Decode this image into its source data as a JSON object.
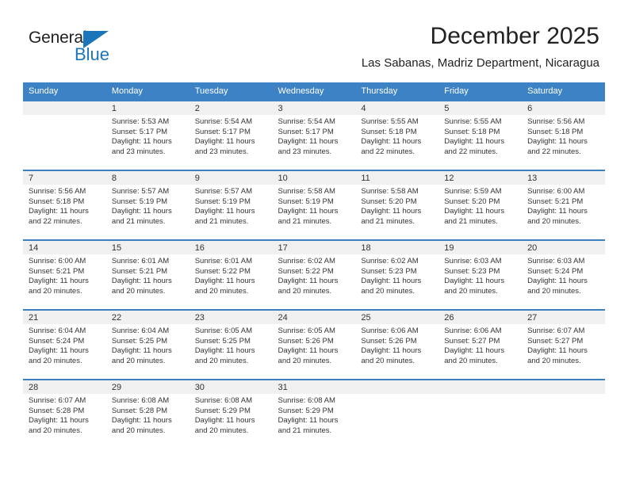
{
  "brand": {
    "name_part1": "General",
    "name_part2": "Blue",
    "accent_color": "#1b75bb",
    "triangle_icon": "triangle-icon"
  },
  "header": {
    "title": "December 2025",
    "subtitle": "Las Sabanas, Madriz Department, Nicaragua"
  },
  "calendar": {
    "header_bg": "#3c82c4",
    "daynum_bg": "#f0f0f0",
    "weekday_names": [
      "Sunday",
      "Monday",
      "Tuesday",
      "Wednesday",
      "Thursday",
      "Friday",
      "Saturday"
    ],
    "weeks": [
      {
        "days": [
          {
            "num": "",
            "lines": []
          },
          {
            "num": "1",
            "lines": [
              "Sunrise: 5:53 AM",
              "Sunset: 5:17 PM",
              "Daylight: 11 hours",
              "and 23 minutes."
            ]
          },
          {
            "num": "2",
            "lines": [
              "Sunrise: 5:54 AM",
              "Sunset: 5:17 PM",
              "Daylight: 11 hours",
              "and 23 minutes."
            ]
          },
          {
            "num": "3",
            "lines": [
              "Sunrise: 5:54 AM",
              "Sunset: 5:17 PM",
              "Daylight: 11 hours",
              "and 23 minutes."
            ]
          },
          {
            "num": "4",
            "lines": [
              "Sunrise: 5:55 AM",
              "Sunset: 5:18 PM",
              "Daylight: 11 hours",
              "and 22 minutes."
            ]
          },
          {
            "num": "5",
            "lines": [
              "Sunrise: 5:55 AM",
              "Sunset: 5:18 PM",
              "Daylight: 11 hours",
              "and 22 minutes."
            ]
          },
          {
            "num": "6",
            "lines": [
              "Sunrise: 5:56 AM",
              "Sunset: 5:18 PM",
              "Daylight: 11 hours",
              "and 22 minutes."
            ]
          }
        ]
      },
      {
        "days": [
          {
            "num": "7",
            "lines": [
              "Sunrise: 5:56 AM",
              "Sunset: 5:18 PM",
              "Daylight: 11 hours",
              "and 22 minutes."
            ]
          },
          {
            "num": "8",
            "lines": [
              "Sunrise: 5:57 AM",
              "Sunset: 5:19 PM",
              "Daylight: 11 hours",
              "and 21 minutes."
            ]
          },
          {
            "num": "9",
            "lines": [
              "Sunrise: 5:57 AM",
              "Sunset: 5:19 PM",
              "Daylight: 11 hours",
              "and 21 minutes."
            ]
          },
          {
            "num": "10",
            "lines": [
              "Sunrise: 5:58 AM",
              "Sunset: 5:19 PM",
              "Daylight: 11 hours",
              "and 21 minutes."
            ]
          },
          {
            "num": "11",
            "lines": [
              "Sunrise: 5:58 AM",
              "Sunset: 5:20 PM",
              "Daylight: 11 hours",
              "and 21 minutes."
            ]
          },
          {
            "num": "12",
            "lines": [
              "Sunrise: 5:59 AM",
              "Sunset: 5:20 PM",
              "Daylight: 11 hours",
              "and 21 minutes."
            ]
          },
          {
            "num": "13",
            "lines": [
              "Sunrise: 6:00 AM",
              "Sunset: 5:21 PM",
              "Daylight: 11 hours",
              "and 20 minutes."
            ]
          }
        ]
      },
      {
        "days": [
          {
            "num": "14",
            "lines": [
              "Sunrise: 6:00 AM",
              "Sunset: 5:21 PM",
              "Daylight: 11 hours",
              "and 20 minutes."
            ]
          },
          {
            "num": "15",
            "lines": [
              "Sunrise: 6:01 AM",
              "Sunset: 5:21 PM",
              "Daylight: 11 hours",
              "and 20 minutes."
            ]
          },
          {
            "num": "16",
            "lines": [
              "Sunrise: 6:01 AM",
              "Sunset: 5:22 PM",
              "Daylight: 11 hours",
              "and 20 minutes."
            ]
          },
          {
            "num": "17",
            "lines": [
              "Sunrise: 6:02 AM",
              "Sunset: 5:22 PM",
              "Daylight: 11 hours",
              "and 20 minutes."
            ]
          },
          {
            "num": "18",
            "lines": [
              "Sunrise: 6:02 AM",
              "Sunset: 5:23 PM",
              "Daylight: 11 hours",
              "and 20 minutes."
            ]
          },
          {
            "num": "19",
            "lines": [
              "Sunrise: 6:03 AM",
              "Sunset: 5:23 PM",
              "Daylight: 11 hours",
              "and 20 minutes."
            ]
          },
          {
            "num": "20",
            "lines": [
              "Sunrise: 6:03 AM",
              "Sunset: 5:24 PM",
              "Daylight: 11 hours",
              "and 20 minutes."
            ]
          }
        ]
      },
      {
        "days": [
          {
            "num": "21",
            "lines": [
              "Sunrise: 6:04 AM",
              "Sunset: 5:24 PM",
              "Daylight: 11 hours",
              "and 20 minutes."
            ]
          },
          {
            "num": "22",
            "lines": [
              "Sunrise: 6:04 AM",
              "Sunset: 5:25 PM",
              "Daylight: 11 hours",
              "and 20 minutes."
            ]
          },
          {
            "num": "23",
            "lines": [
              "Sunrise: 6:05 AM",
              "Sunset: 5:25 PM",
              "Daylight: 11 hours",
              "and 20 minutes."
            ]
          },
          {
            "num": "24",
            "lines": [
              "Sunrise: 6:05 AM",
              "Sunset: 5:26 PM",
              "Daylight: 11 hours",
              "and 20 minutes."
            ]
          },
          {
            "num": "25",
            "lines": [
              "Sunrise: 6:06 AM",
              "Sunset: 5:26 PM",
              "Daylight: 11 hours",
              "and 20 minutes."
            ]
          },
          {
            "num": "26",
            "lines": [
              "Sunrise: 6:06 AM",
              "Sunset: 5:27 PM",
              "Daylight: 11 hours",
              "and 20 minutes."
            ]
          },
          {
            "num": "27",
            "lines": [
              "Sunrise: 6:07 AM",
              "Sunset: 5:27 PM",
              "Daylight: 11 hours",
              "and 20 minutes."
            ]
          }
        ]
      },
      {
        "days": [
          {
            "num": "28",
            "lines": [
              "Sunrise: 6:07 AM",
              "Sunset: 5:28 PM",
              "Daylight: 11 hours",
              "and 20 minutes."
            ]
          },
          {
            "num": "29",
            "lines": [
              "Sunrise: 6:08 AM",
              "Sunset: 5:28 PM",
              "Daylight: 11 hours",
              "and 20 minutes."
            ]
          },
          {
            "num": "30",
            "lines": [
              "Sunrise: 6:08 AM",
              "Sunset: 5:29 PM",
              "Daylight: 11 hours",
              "and 20 minutes."
            ]
          },
          {
            "num": "31",
            "lines": [
              "Sunrise: 6:08 AM",
              "Sunset: 5:29 PM",
              "Daylight: 11 hours",
              "and 21 minutes."
            ]
          },
          {
            "num": "",
            "lines": []
          },
          {
            "num": "",
            "lines": []
          },
          {
            "num": "",
            "lines": []
          }
        ]
      }
    ]
  }
}
